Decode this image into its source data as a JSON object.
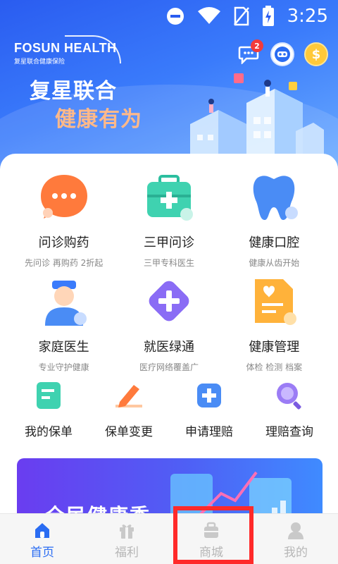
{
  "status": {
    "time": "3:25"
  },
  "brand": {
    "logo_main": "FOSUN HEALTH",
    "logo_sub": "复星联合健康保险"
  },
  "hero": {
    "slogan_line1": "复星联合",
    "slogan_line2": "健康有为"
  },
  "header_icons": {
    "message_badge": "2",
    "coin_symbol": "$"
  },
  "services_top": [
    {
      "title": "问诊购药",
      "subtitle": "先问诊 再购药 2折起",
      "icon": "chat-bubble-icon"
    },
    {
      "title": "三甲问诊",
      "subtitle": "三甲专科医生",
      "icon": "medical-kit-icon"
    },
    {
      "title": "健康口腔",
      "subtitle": "健康从齿开始",
      "icon": "tooth-icon"
    }
  ],
  "services_mid": [
    {
      "title": "家庭医生",
      "subtitle": "专业守护健康",
      "icon": "doctor-icon"
    },
    {
      "title": "就医绿通",
      "subtitle": "医疗网络覆盖广",
      "icon": "green-channel-icon"
    },
    {
      "title": "健康管理",
      "subtitle": "体检 检测 档案",
      "icon": "health-record-icon"
    }
  ],
  "quick_actions": [
    {
      "label": "我的保单",
      "icon": "policy-icon"
    },
    {
      "label": "保单变更",
      "icon": "edit-policy-icon"
    },
    {
      "label": "申请理赔",
      "icon": "claim-apply-icon"
    },
    {
      "label": "理赔查询",
      "icon": "claim-search-icon"
    }
  ],
  "banner": {
    "text": "全民健康季"
  },
  "tabbar": [
    {
      "label": "首页",
      "icon": "home-icon",
      "active": true
    },
    {
      "label": "福利",
      "icon": "gift-icon",
      "active": false
    },
    {
      "label": "商城",
      "icon": "shop-icon",
      "active": false
    },
    {
      "label": "我的",
      "icon": "profile-icon",
      "active": false
    }
  ],
  "colors": {
    "primary": "#2a6cf2",
    "accent_orange": "#ffb98a",
    "highlight": "#ff2a2a"
  }
}
